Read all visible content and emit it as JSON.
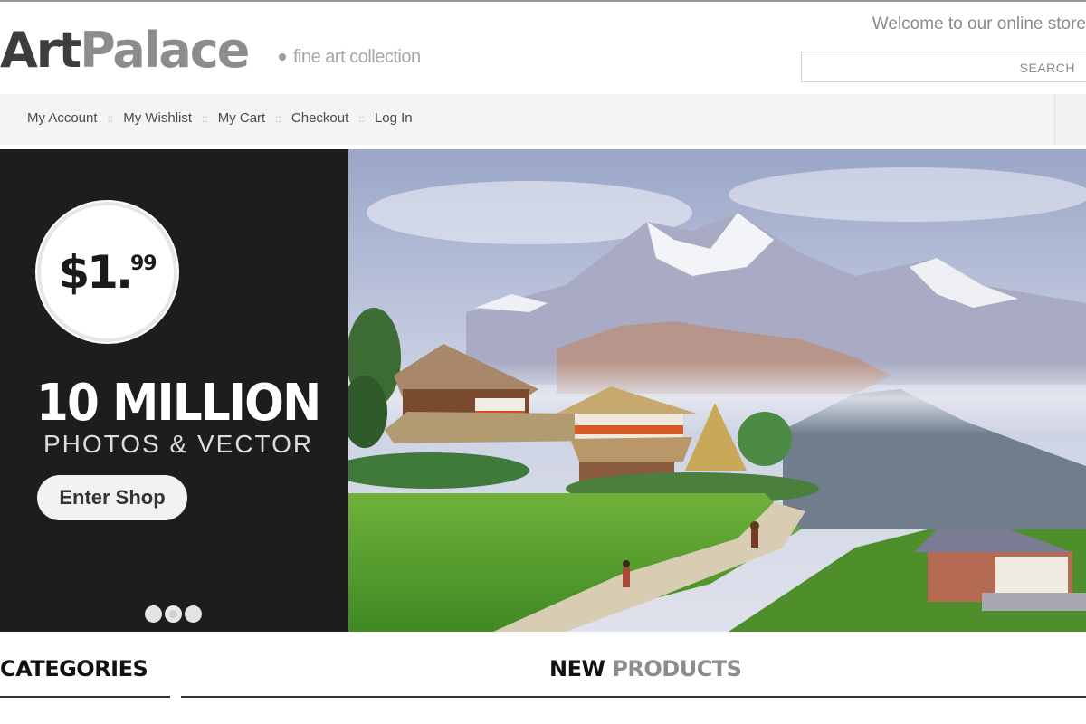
{
  "header": {
    "logo_part1": "Art",
    "logo_part2": "Palace",
    "tagline": "fine art collection",
    "welcome": "Welcome to our online store",
    "search": {
      "placeholder": "",
      "button_label": "SEARCH"
    }
  },
  "nav": {
    "items": [
      {
        "label": "My Account"
      },
      {
        "label": "My Wishlist"
      },
      {
        "label": "My Cart"
      },
      {
        "label": "Checkout"
      },
      {
        "label": "Log In"
      }
    ],
    "separator": "::"
  },
  "promo": {
    "price_dollars": "$1.",
    "price_cents": "99",
    "headline": "10 MILLION",
    "subline": "PHOTOS & VECTOR",
    "button_label": "Enter Shop",
    "slides_count": 3,
    "active_slide": 2
  },
  "sections": {
    "categories": "CATEGORIES",
    "new_products_word1": "NEW",
    "new_products_word2": "PRODUCTS"
  },
  "colors": {
    "promo_bg": "#1d1d1d",
    "nav_bg": "#f4f4f4",
    "logo_dark": "#3d3d3d",
    "logo_light": "#8c8c8c"
  }
}
